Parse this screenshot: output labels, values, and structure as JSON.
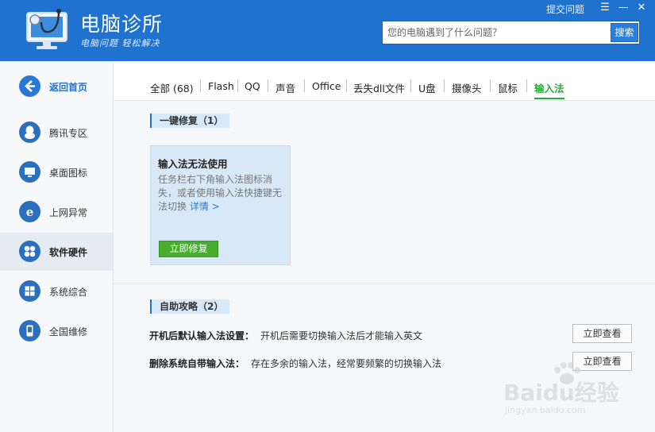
{
  "header": {
    "title": "电脑诊所",
    "slogan": "电脑问题 轻松解决",
    "top_link": "提交问题",
    "search_placeholder": "您的电脑遇到了什么问题？",
    "search_button": "搜索",
    "brand_color": "#1f72cf"
  },
  "sidebar": {
    "items": [
      {
        "label": "返回首页",
        "icon": "back-arrow-icon"
      },
      {
        "label": "腾讯专区",
        "icon": "qq-penguin-icon"
      },
      {
        "label": "桌面图标",
        "icon": "monitor-icon"
      },
      {
        "label": "上网异常",
        "icon": "ie-browser-icon"
      },
      {
        "label": "软件硬件",
        "icon": "hardware-icon"
      },
      {
        "label": "系统综合",
        "icon": "windows-logo-icon"
      },
      {
        "label": "全国维修",
        "icon": "phone-icon"
      }
    ],
    "active_index": 4
  },
  "tabs": [
    "全部 (68)",
    "Flash",
    "QQ",
    "声音",
    "Office",
    "丢失dll文件",
    "U盘",
    "摄像头",
    "鼠标",
    "输入法"
  ],
  "active_tab": "输入法",
  "quick_fix": {
    "heading": "一键修复（1）",
    "card": {
      "title": "输入法无法使用",
      "desc": "任务栏右下角输入法图标消失，或者使用输入法快捷键无法切换",
      "link": "详情 >",
      "button": "立即修复"
    }
  },
  "guides": {
    "heading": "自助攻略（2）",
    "items": [
      {
        "title": "开机后默认输入法设置：",
        "desc": "开机后需要切换输入法后才能输入英文",
        "button": "立即查看"
      },
      {
        "title": "删除系统自带输入法：",
        "desc": "存在多余的输入法，经常要频繁的切换输入法",
        "button": "立即查看"
      }
    ]
  },
  "watermark": {
    "text": "Baidu经验",
    "sub": "jingyan.baidu.com"
  }
}
